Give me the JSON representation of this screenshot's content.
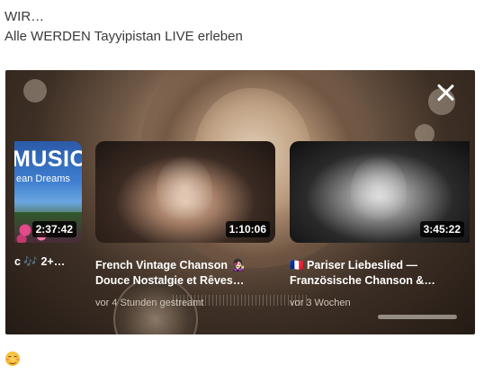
{
  "post": {
    "line1": "WIR…",
    "line2": "Alle WERDEN Tayyipistan LIVE erleben"
  },
  "player": {
    "close_icon": "close-icon",
    "cards": [
      {
        "thumb_title": "MUSIC",
        "thumb_subtitle": "ean Dreams",
        "duration": "2:37:42",
        "title_line1": "c 🎶 2+…",
        "title_line2": "",
        "meta": ""
      },
      {
        "duration": "1:10:06",
        "title_line1": "French Vintage Chanson 👩🏻‍🎤",
        "title_line2": "Douce Nostalgie et Rêves…",
        "meta": "vor 4 Stunden gestreamt"
      },
      {
        "duration": "3:45:22",
        "title_line1": "🇫🇷 Pariser Liebeslied —",
        "title_line2": "Französische Chanson &…",
        "meta": "vor 3 Wochen"
      }
    ]
  },
  "reaction": {
    "emoji_icon": "smiling-face-icon"
  }
}
